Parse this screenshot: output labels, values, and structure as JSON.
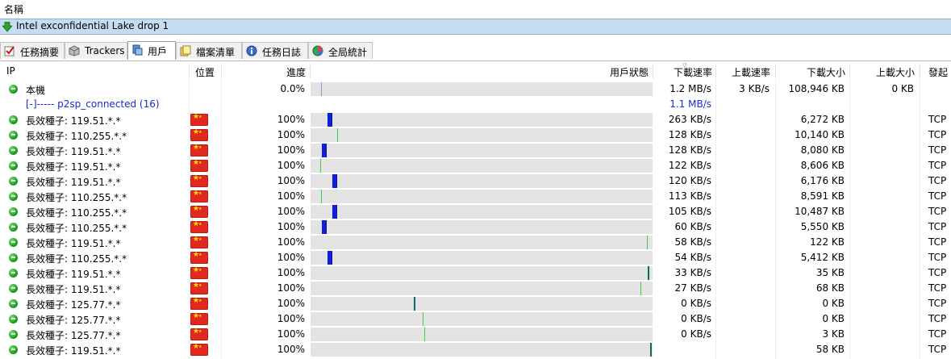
{
  "header": {
    "name_label": "名稱"
  },
  "task": {
    "title": "Intel exconfidential Lake drop 1"
  },
  "tabs": [
    {
      "label": "任務摘要",
      "icon": "check-icon",
      "active": false
    },
    {
      "label": "Trackers",
      "icon": "cube-icon",
      "active": false
    },
    {
      "label": "用戶",
      "icon": "users-icon",
      "active": true
    },
    {
      "label": "檔案清單",
      "icon": "files-icon",
      "active": false
    },
    {
      "label": "任務日誌",
      "icon": "info-icon",
      "active": false
    },
    {
      "label": "全局統計",
      "icon": "stats-icon",
      "active": false
    }
  ],
  "columns": {
    "ip": "IP",
    "location": "位置",
    "progress": "進度",
    "status": "用戶狀態",
    "down_rate": "下載速率",
    "up_rate": "上載速率",
    "down_size": "下載大小",
    "up_size": "上載大小",
    "origin": "發起"
  },
  "colors": {
    "bar_bg": "#e3e3e3",
    "mark_blue": "#1020d8",
    "mark_green": "#3cd13c",
    "mark_teal": "#0a6a60",
    "group_text": "#1d2ad1"
  },
  "local": {
    "ip": "本機",
    "progress": "0.0%",
    "down_rate": "1.2 MB/s",
    "up_rate": "3 KB/s",
    "down_size": "108,946 KB",
    "up_size": "0 KB",
    "mark": 0.03
  },
  "group": {
    "label": "[-]----- p2sp_connected (16)",
    "down_rate": "1.1 MB/s"
  },
  "peers": [
    {
      "ip": "長效種子: 119.51.*.*",
      "progress": "100%",
      "down_rate": "263 KB/s",
      "down_size": "6,272 KB",
      "origin": "TCP",
      "mark": 0.05,
      "mark_type": "blue"
    },
    {
      "ip": "長效種子: 110.255.*.*",
      "progress": "100%",
      "down_rate": "128 KB/s",
      "down_size": "10,140 KB",
      "origin": "TCP",
      "mark": 0.078,
      "mark_type": "green"
    },
    {
      "ip": "長效種子: 119.51.*.*",
      "progress": "100%",
      "down_rate": "128 KB/s",
      "down_size": "8,080 KB",
      "origin": "TCP",
      "mark": 0.033,
      "mark_type": "blue"
    },
    {
      "ip": "長效種子: 119.51.*.*",
      "progress": "100%",
      "down_rate": "122 KB/s",
      "down_size": "8,606 KB",
      "origin": "TCP",
      "mark": 0.028,
      "mark_type": "green"
    },
    {
      "ip": "長效種子: 119.51.*.*",
      "progress": "100%",
      "down_rate": "120 KB/s",
      "down_size": "6,176 KB",
      "origin": "TCP",
      "mark": 0.063,
      "mark_type": "blue"
    },
    {
      "ip": "長效種子: 110.255.*.*",
      "progress": "100%",
      "down_rate": "113 KB/s",
      "down_size": "8,591 KB",
      "origin": "TCP",
      "mark": 0.03,
      "mark_type": "green"
    },
    {
      "ip": "長效種子: 110.255.*.*",
      "progress": "100%",
      "down_rate": "105 KB/s",
      "down_size": "10,487 KB",
      "origin": "TCP",
      "mark": 0.063,
      "mark_type": "blue"
    },
    {
      "ip": "長效種子: 110.255.*.*",
      "progress": "100%",
      "down_rate": "60 KB/s",
      "down_size": "5,550 KB",
      "origin": "TCP",
      "mark": 0.033,
      "mark_type": "blue"
    },
    {
      "ip": "長效種子: 119.51.*.*",
      "progress": "100%",
      "down_rate": "58 KB/s",
      "down_size": "122 KB",
      "origin": "TCP",
      "mark": 0.983,
      "mark_type": "green"
    },
    {
      "ip": "長效種子: 110.255.*.*",
      "progress": "100%",
      "down_rate": "54 KB/s",
      "down_size": "5,412 KB",
      "origin": "TCP",
      "mark": 0.05,
      "mark_type": "blue"
    },
    {
      "ip": "長效種子: 119.51.*.*",
      "progress": "100%",
      "down_rate": "33 KB/s",
      "down_size": "35 KB",
      "origin": "TCP",
      "mark": 0.986,
      "mark_type": "teal"
    },
    {
      "ip": "長效種子: 119.51.*.*",
      "progress": "100%",
      "down_rate": "27 KB/s",
      "down_size": "68 KB",
      "origin": "TCP",
      "mark": 0.965,
      "mark_type": "green"
    },
    {
      "ip": "長效種子: 125.77.*.*",
      "progress": "100%",
      "down_rate": "0 KB/s",
      "down_size": "0 KB",
      "origin": "TCP",
      "mark": 0.302,
      "mark_type": "teal"
    },
    {
      "ip": "長效種子: 125.77.*.*",
      "progress": "100%",
      "down_rate": "0 KB/s",
      "down_size": "0 KB",
      "origin": "TCP",
      "mark": 0.328,
      "mark_type": "green"
    },
    {
      "ip": "長效種子: 125.77.*.*",
      "progress": "100%",
      "down_rate": "0 KB/s",
      "down_size": "3 KB",
      "origin": "TCP",
      "mark": 0.333,
      "mark_type": "green"
    },
    {
      "ip": "長效種子: 119.51.*.*",
      "progress": "100%",
      "down_rate": "",
      "down_size": "58 KB",
      "origin": "TCP",
      "mark": 0.993,
      "mark_type": "teal"
    }
  ]
}
